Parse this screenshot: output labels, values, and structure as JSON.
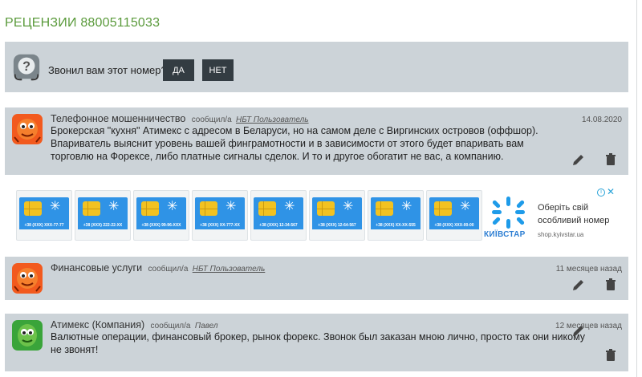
{
  "page": {
    "title": "РЕЦЕНЗИИ 88005115033"
  },
  "poll": {
    "question": "Звонил вам этот номер?",
    "yes_label": "ДА",
    "no_label": "НЕТ"
  },
  "reviews": [
    {
      "category": "Телефонное мошенничество",
      "posted_by": "сообщил/а",
      "user": "НБТ Пользователь",
      "date": "14.08.2020",
      "text": "Брокерская \"кухня\" Атимекс с адресом в Беларуси, но на самом деле с Виргинских островов (оффшор). Впариватель выяснит уровень вашей финграмотности и в зависимости от этого будет впаривать вам торговлю на Форексе, либо платные сигналы сделок. И то и другое обогатит не вас, а компанию."
    },
    {
      "category": "Финансовые услуги",
      "posted_by": "сообщил/а",
      "user": "НБТ Пользователь",
      "date": "11 месяцев назад",
      "text": ""
    },
    {
      "category": "Атимекс (Компания)",
      "posted_by": "сообщил/а",
      "user": "Павел",
      "date": "12 месяцев назад",
      "text": "Валютные операции, финансовый брокер, рынок форекс. Звонок был заказан мною лично, просто так они никому не звонят!"
    }
  ],
  "ad": {
    "sim_numbers": [
      "+38 (XXX) XXX-77-77",
      "+38 (XXX) 222-22-XX",
      "+38 (XXX) 99-96-XXX",
      "+38 (XXX) XX-777-XX",
      "+38 (XXX) 12-34-567",
      "+38 (XXX) 12-64-567",
      "+38 (XXX) XX-XX-555",
      "+38 (XXX) XXX-00-00"
    ],
    "headline": "Оберіть свій особливий номер",
    "brand": "КИЇВСТАР",
    "url": "shop.kyivstar.ua",
    "info_icon": "i",
    "close_icon": "✕"
  },
  "colors": {
    "title_green": "#5a9a3b",
    "panel_gray": "#ccd3d8",
    "button_dark": "#333c42",
    "kyivstar_blue": "#2e7fd3",
    "sim_blue": "#2f93e6"
  }
}
